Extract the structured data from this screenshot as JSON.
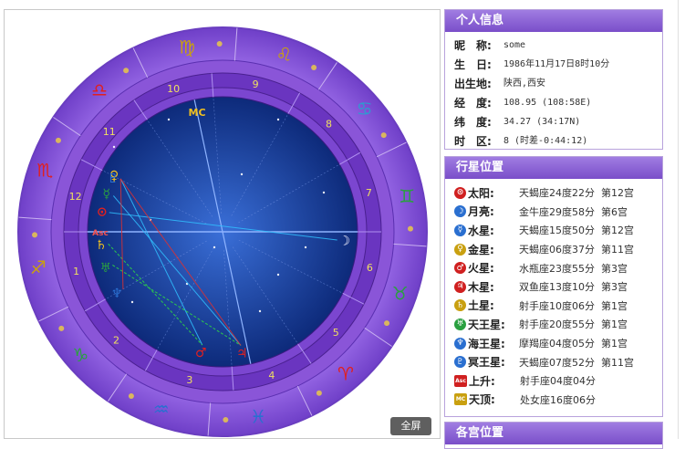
{
  "fullscreen_label": "全屏",
  "personal": {
    "header": "个人信息",
    "rows": [
      {
        "label": "昵　称:",
        "value": "some"
      },
      {
        "label": "生　日:",
        "value": "1986年11月17日8时10分"
      },
      {
        "label": "出生地:",
        "value": "陕西,西安"
      },
      {
        "label": "经　度:",
        "value": "108.95 (108:58E)"
      },
      {
        "label": "纬　度:",
        "value": "34.27 (34:17N)"
      },
      {
        "label": "时　区:",
        "value": "8 (时差-0:44:12)"
      }
    ]
  },
  "planets": {
    "header": "行星位置",
    "rows": [
      {
        "icon": "⊙",
        "color": "#d02020",
        "name": "太阳:",
        "sign": "天蝎座24度22分",
        "house": "第12宫"
      },
      {
        "icon": "☽",
        "color": "#2a6fd0",
        "name": "月亮:",
        "sign": "金牛座29度58分",
        "house": "第6宫"
      },
      {
        "icon": "☿",
        "color": "#2a6fd0",
        "name": "水星:",
        "sign": "天蝎座15度50分",
        "house": "第12宫"
      },
      {
        "icon": "♀",
        "color": "#c9a010",
        "name": "金星:",
        "sign": "天蝎座06度37分",
        "house": "第11宫"
      },
      {
        "icon": "♂",
        "color": "#d02020",
        "name": "火星:",
        "sign": "水瓶座23度55分",
        "house": "第3宫"
      },
      {
        "icon": "♃",
        "color": "#d02020",
        "name": "木星:",
        "sign": "双鱼座13度10分",
        "house": "第3宫"
      },
      {
        "icon": "♄",
        "color": "#c9a010",
        "name": "土星:",
        "sign": "射手座10度06分",
        "house": "第1宫"
      },
      {
        "icon": "♅",
        "color": "#2aa040",
        "name": "天王星:",
        "sign": "射手座20度55分",
        "house": "第1宫"
      },
      {
        "icon": "♆",
        "color": "#2a6fd0",
        "name": "海王星:",
        "sign": "摩羯座04度05分",
        "house": "第1宫"
      },
      {
        "icon": "♇",
        "color": "#2a6fd0",
        "name": "冥王星:",
        "sign": "天蝎座07度52分",
        "house": "第11宫"
      },
      {
        "icon": "Asc",
        "color": "#d02020",
        "name": "上升:",
        "sign": "射手座04度04分",
        "house": ""
      },
      {
        "icon": "MC",
        "color": "#c9a010",
        "name": "天顶:",
        "sign": "处女座16度06分",
        "house": ""
      }
    ]
  },
  "houses": {
    "header": "各宫位置"
  },
  "wheel": {
    "signs": [
      "♈",
      "♉",
      "♊",
      "♋",
      "♌",
      "♍",
      "♎",
      "♏",
      "♐",
      "♑",
      "♒",
      "♓"
    ],
    "sign_colors": [
      "#e02020",
      "#2aa040",
      "#2aa040",
      "#2a9fd0",
      "#c9a010",
      "#c9a010",
      "#e02020",
      "#e02020",
      "#c9a010",
      "#2aa040",
      "#2a6fd0",
      "#2a6fd0"
    ],
    "house_numbers": [
      "1",
      "2",
      "3",
      "4",
      "5",
      "6",
      "7",
      "8",
      "9",
      "10",
      "11",
      "12"
    ],
    "planet_markers": [
      {
        "glyph": "♀",
        "color": "#f0c020",
        "lon": 216.6
      },
      {
        "glyph": "♇",
        "color": "#2a6fd0",
        "lon": 217.9
      },
      {
        "glyph": "☿",
        "color": "#2aa040",
        "lon": 225.8
      },
      {
        "glyph": "⊙",
        "color": "#e02020",
        "lon": 234.4
      },
      {
        "glyph": "♄",
        "color": "#f0c020",
        "lon": 250.1
      },
      {
        "glyph": "♅",
        "color": "#2aa040",
        "lon": 260.9
      },
      {
        "glyph": "♆",
        "color": "#2a6fd0",
        "lon": 274.1
      },
      {
        "glyph": "♂",
        "color": "#e02020",
        "lon": 323.9
      },
      {
        "glyph": "♃",
        "color": "#e02020",
        "lon": 343.2
      },
      {
        "glyph": "☽",
        "color": "#f0f0ff",
        "lon": 59.97
      }
    ],
    "asc_label": "Asc",
    "mc_label": "MC"
  }
}
